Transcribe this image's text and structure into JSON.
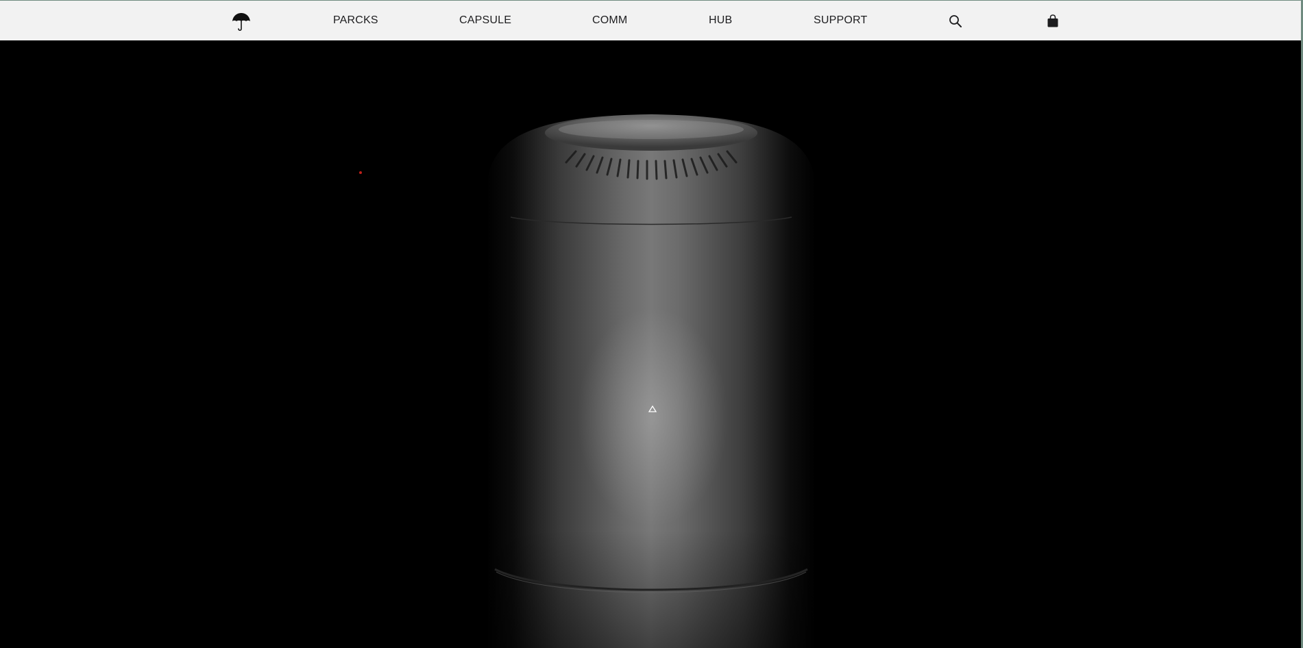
{
  "nav": {
    "logo_icon": "umbrella-icon",
    "items": [
      {
        "label": "PARCKS"
      },
      {
        "label": "CAPSULE"
      },
      {
        "label": "COMM"
      },
      {
        "label": "HUB"
      },
      {
        "label": "SUPPORT"
      }
    ],
    "search_icon": "search-icon",
    "bag_icon": "shopping-bag-icon"
  },
  "hero": {
    "product_icon": "cylindrical-device",
    "badge_icon": "triangle-logo-icon"
  },
  "colors": {
    "navbar_bg": "#f2f2f2",
    "nav_text": "#1d1d1f",
    "hero_bg": "#000000",
    "indicator": "#c0201a"
  }
}
